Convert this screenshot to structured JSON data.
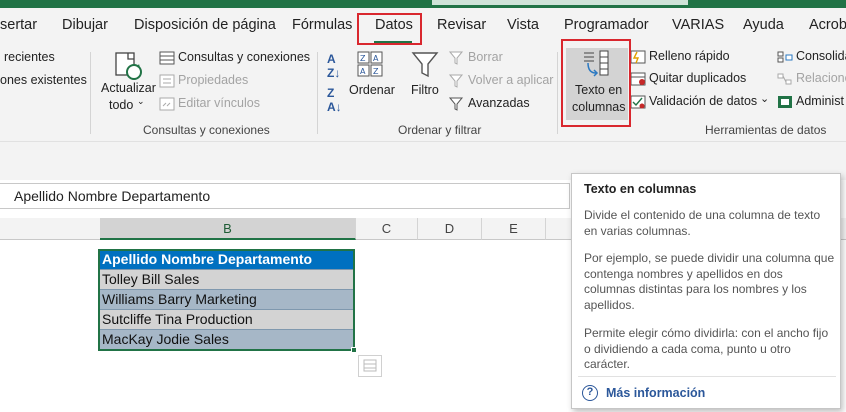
{
  "tabs": [
    {
      "label": "sertar"
    },
    {
      "label": "Dibujar"
    },
    {
      "label": "Disposición de página"
    },
    {
      "label": "Fórmulas"
    },
    {
      "label": "Datos"
    },
    {
      "label": "Revisar"
    },
    {
      "label": "Vista"
    },
    {
      "label": "Programador"
    },
    {
      "label": "VARIAS"
    },
    {
      "label": "Ayuda"
    },
    {
      "label": "Acroba"
    }
  ],
  "ribbon": {
    "left_partial": [
      "recientes",
      "ones existentes"
    ],
    "queries_group": {
      "refresh_label_line1": "Actualizar",
      "refresh_label_line2": "todo",
      "queries_connections": "Consultas y conexiones",
      "properties": "Propiedades",
      "edit_links": "Editar vínculos",
      "group_label": "Consultas y conexiones"
    },
    "sort_filter_group": {
      "sort_label": "Ordenar",
      "filter_label": "Filtro",
      "clear_label": "Borrar",
      "reapply_label": "Volver a aplicar",
      "advanced_label": "Avanzadas",
      "group_label": "Ordenar y filtrar"
    },
    "data_tools_group": {
      "text_to_columns_line1": "Texto en",
      "text_to_columns_line2": "columnas",
      "flash_fill": "Relleno rápido",
      "remove_duplicates": "Quitar duplicados",
      "data_validation": "Validación de datos",
      "consolidate": "Consolida",
      "relationships": "Relacione",
      "manage": "Administ",
      "group_label": "Herramientas de datos"
    }
  },
  "formula_bar": {
    "value": "Apellido Nombre Departamento"
  },
  "columns": [
    "B",
    "C",
    "D",
    "E"
  ],
  "cells": [
    "Apellido Nombre Departamento",
    "Tolley Bill Sales",
    "Williams Barry Marketing",
    "Sutcliffe Tina Production",
    "MacKay Jodie Sales"
  ],
  "tooltip": {
    "title": "Texto en columnas",
    "p1": "Divide el contenido de una columna de texto en varias columnas.",
    "p2": "Por ejemplo, se puede dividir una columna que contenga nombres y apellidos en dos columnas distintas para los nombres y los apellidos.",
    "p3": "Permite elegir cómo dividirla: con el ancho fijo o dividiendo a cada coma, punto u otro carácter.",
    "more": "Más información"
  },
  "colors": {
    "excel_green": "#217346",
    "highlight_red": "#d9272e",
    "header_blue": "#0070c0"
  }
}
